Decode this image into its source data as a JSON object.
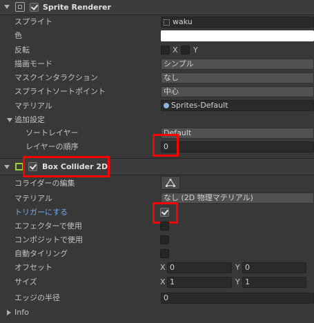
{
  "sprite_renderer": {
    "title": "Sprite Renderer",
    "rows": {
      "sprite_label": "スプライト",
      "sprite_value": "waku",
      "color_label": "色",
      "flip_label": "反転",
      "flip_x": "X",
      "flip_y": "Y",
      "draw_mode_label": "描画モード",
      "draw_mode_value": "シンプル",
      "mask_label": "マスクインタラクション",
      "mask_value": "なし",
      "sort_point_label": "スプライトソートポイント",
      "sort_point_value": "中心",
      "material_label": "マテリアル",
      "material_value": "Sprites-Default"
    },
    "additional": {
      "label": "追加設定",
      "sorting_layer_label": "ソートレイヤー",
      "sorting_layer_value": "Default",
      "order_label": "レイヤーの順序",
      "order_value": "0"
    }
  },
  "box_collider": {
    "title": "Box Collider 2D",
    "edit_label": "コライダーの編集",
    "material_label": "マテリアル",
    "material_value": "なし (2D 物理マテリアル)",
    "trigger_label": "トリガーにする",
    "trigger_checked": true,
    "effector_label": "エフェクターで使用",
    "composite_label": "コンポジットで使用",
    "autotiling_label": "自動タイリング",
    "offset_label": "オフセット",
    "offset_x": "0",
    "offset_y": "0",
    "size_label": "サイズ",
    "size_x": "1",
    "size_y": "1",
    "edge_radius_label": "エッジの半径",
    "edge_radius_value": "0",
    "x_label": "X",
    "y_label": "Y"
  },
  "info": {
    "label": "Info"
  },
  "colors": {
    "highlight_red": "#ff0000",
    "trigger_label_blue": "#6fa8ef",
    "panel": "#383838"
  }
}
